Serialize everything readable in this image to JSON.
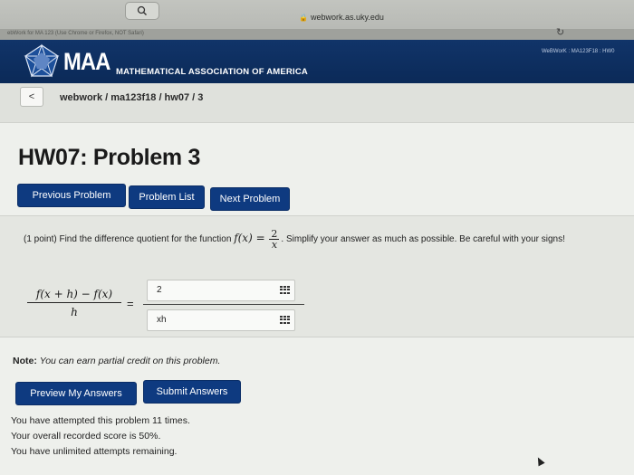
{
  "browser": {
    "url": "webwork.as.uky.edu",
    "tab_left": "ebWork for MA 123 (Use Chrome or Firefox, NOT Safari)",
    "tab_right": "WeBWorK : MA123F18 : HW0"
  },
  "banner": {
    "logo_text": "MAA",
    "subtitle": "MATHEMATICAL ASSOCIATION OF AMERICA"
  },
  "breadcrumb": {
    "back_label": "<",
    "path": "webwork / ma123f18 / hw07 / 3"
  },
  "page": {
    "title": "HW07: Problem 3"
  },
  "nav": {
    "previous": "Previous Problem",
    "list": "Problem List",
    "next": "Next Problem"
  },
  "problem": {
    "prefix": "(1 point) Find the difference quotient for the function",
    "function_lhs": "f(x) =",
    "frac_num": "2",
    "frac_den": "x",
    "suffix": ". Simplify your answer as much as possible. Be careful with your signs!",
    "dq_num": "f(x + h) − f(x)",
    "dq_den": "h",
    "equals": "=",
    "answer_numerator": "2",
    "answer_denominator": "xh"
  },
  "note": {
    "label": "Note:",
    "text": "You can earn partial credit on this problem."
  },
  "actions": {
    "preview": "Preview My Answers",
    "submit": "Submit Answers"
  },
  "status": {
    "attempts": "You have attempted this problem 11 times.",
    "score": "Your overall recorded score is 50%.",
    "remaining": "You have unlimited attempts remaining."
  }
}
